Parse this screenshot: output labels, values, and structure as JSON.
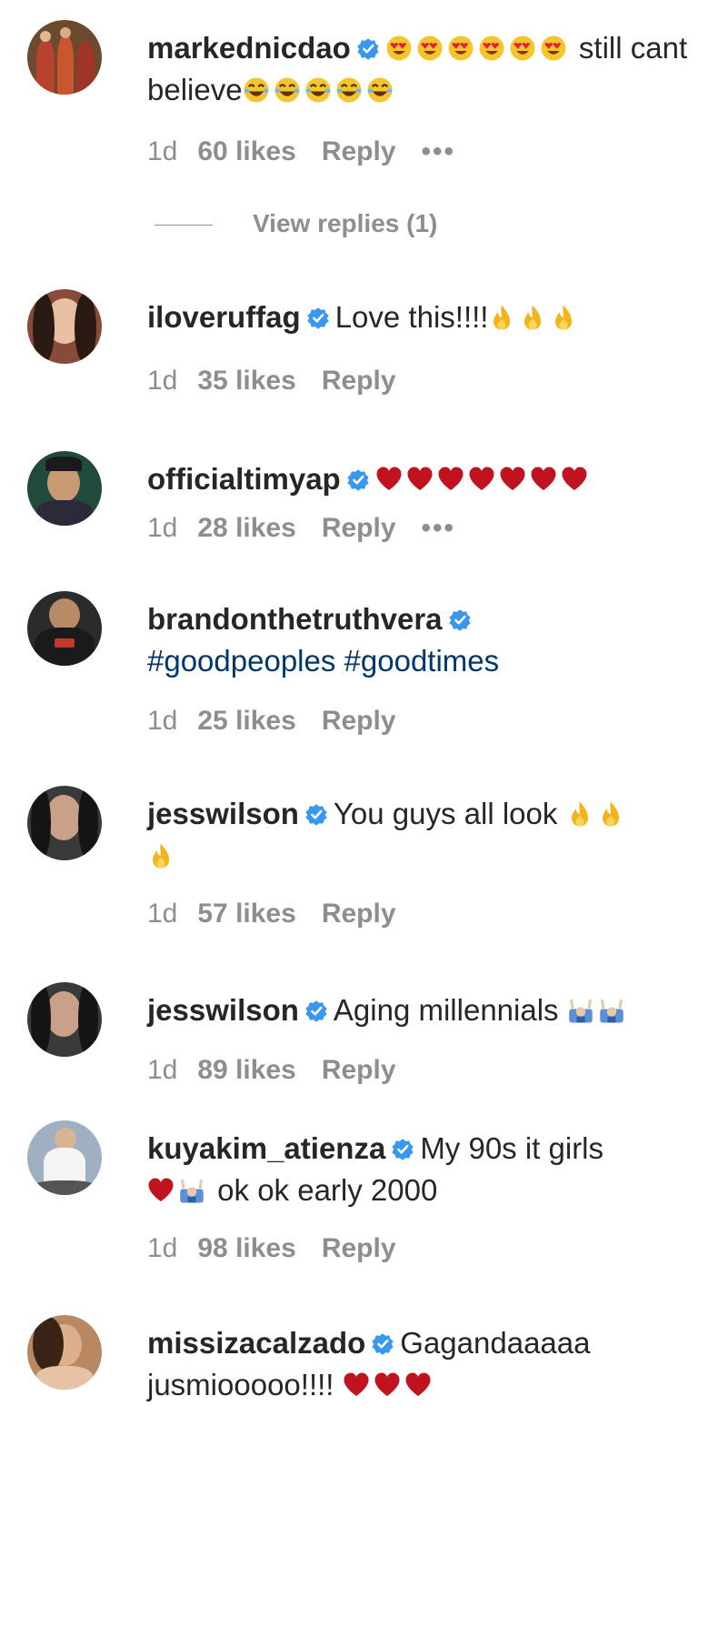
{
  "comments": [
    {
      "username": "markednicdao",
      "text_before": "",
      "text": "still cant believe",
      "age": "1d",
      "likes": "60 likes",
      "reply": "Reply",
      "more": "•••",
      "view_replies": "View replies (1)"
    },
    {
      "username": "iloveruffag",
      "text": "Love this!!!!",
      "age": "1d",
      "likes": "35 likes",
      "reply": "Reply"
    },
    {
      "username": "officialtimyap",
      "text": "",
      "age": "1d",
      "likes": "28 likes",
      "reply": "Reply",
      "more": "•••"
    },
    {
      "username": "brandonthetruthvera",
      "text": "#goodpeoples #goodtimes",
      "age": "1d",
      "likes": "25 likes",
      "reply": "Reply"
    },
    {
      "username": "jesswilson",
      "text": "You guys all look",
      "age": "1d",
      "likes": "57 likes",
      "reply": "Reply"
    },
    {
      "username": "jesswilson",
      "text": "Aging millennials",
      "age": "1d",
      "likes": "89 likes",
      "reply": "Reply"
    },
    {
      "username": "kuyakim_atienza",
      "text": "My 90s it girls",
      "text2": "ok ok early 2000",
      "age": "1d",
      "likes": "98 likes",
      "reply": "Reply"
    },
    {
      "username": "missizacalzado",
      "text": "Gagandaaaaa jusmiooooo!!!!",
      "age": "",
      "likes": "",
      "reply": ""
    }
  ],
  "colors": {
    "verified": "#3897f0",
    "meta": "#8e8e8e",
    "hashtag": "#00376b",
    "heart": "#c1121f"
  },
  "icons": [
    "verified-badge-icon",
    "heart-eyes-emoji",
    "laughing-emoji",
    "fire-emoji",
    "heart-emoji",
    "raising-hands-emoji"
  ]
}
